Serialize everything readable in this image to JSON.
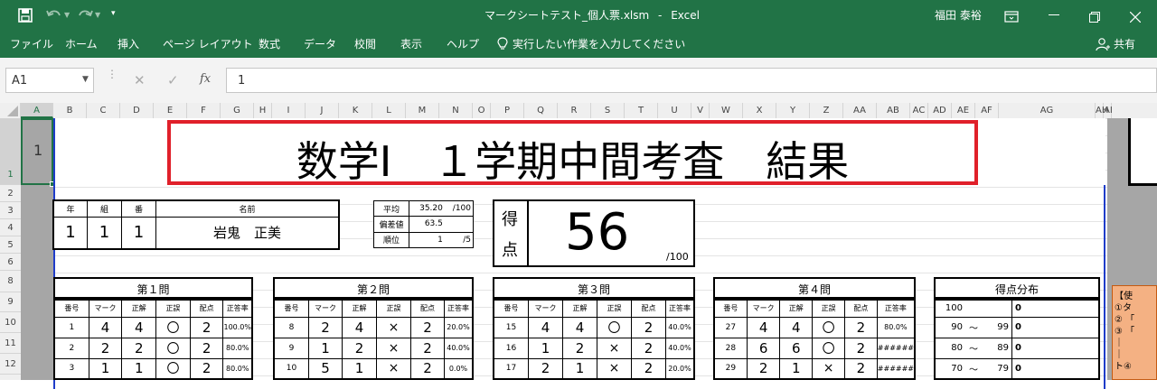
{
  "titlebar": {
    "filename": "マークシートテスト_個人票.xlsm",
    "separator": "-",
    "app": "Excel",
    "user": "福田 泰裕"
  },
  "ribbon": {
    "tabs": [
      "ファイル",
      "ホーム",
      "挿入",
      "ページ レイアウト",
      "数式",
      "データ",
      "校閲",
      "表示",
      "ヘルプ"
    ],
    "tell_me": "実行したい作業を入力してください",
    "share": "共有"
  },
  "formula_bar": {
    "name_box": "A1",
    "formula": "1"
  },
  "columns": [
    "A",
    "B",
    "C",
    "D",
    "E",
    "F",
    "G",
    "H",
    "I",
    "J",
    "K",
    "L",
    "M",
    "N",
    "O",
    "P",
    "Q",
    "R",
    "S",
    "T",
    "U",
    "V",
    "W",
    "X",
    "Y",
    "Z",
    "AA",
    "AB",
    "AC",
    "AD",
    "AE",
    "AF",
    "AG",
    "AH",
    "AI"
  ],
  "rows": [
    "1",
    "2",
    "3",
    "4",
    "5",
    "6",
    "8",
    "9",
    "10",
    "11",
    "12"
  ],
  "sheet": {
    "a1_value": "1",
    "title": "数学Ⅰ　１学期中間考査　結果",
    "student": {
      "headers": [
        "年",
        "組",
        "番",
        "名前"
      ],
      "values": [
        "1",
        "1",
        "1",
        "岩鬼　正美"
      ]
    },
    "stats": {
      "avg_label": "平均",
      "avg_value": "35.20",
      "avg_unit": "/100",
      "dev_label": "偏差値",
      "dev_value": "63.5",
      "rank_label": "順位",
      "rank_value": "1",
      "rank_unit": "/5"
    },
    "score": {
      "label1": "得",
      "label2": "点",
      "value": "56",
      "unit": "/100"
    },
    "questions": [
      {
        "title": "第１問",
        "headers": [
          "番号",
          "マーク",
          "正解",
          "正誤",
          "配点",
          "正答率"
        ],
        "rows": [
          [
            "1",
            "4",
            "4",
            "〇",
            "2",
            "100.0%"
          ],
          [
            "2",
            "2",
            "2",
            "〇",
            "2",
            "80.0%"
          ],
          [
            "3",
            "1",
            "1",
            "〇",
            "2",
            "80.0%"
          ]
        ]
      },
      {
        "title": "第２問",
        "headers": [
          "番号",
          "マーク",
          "正解",
          "正誤",
          "配点",
          "正答率"
        ],
        "rows": [
          [
            "8",
            "2",
            "4",
            "×",
            "2",
            "20.0%"
          ],
          [
            "9",
            "1",
            "2",
            "×",
            "2",
            "40.0%"
          ],
          [
            "10",
            "5",
            "1",
            "×",
            "2",
            "0.0%"
          ]
        ]
      },
      {
        "title": "第３問",
        "headers": [
          "番号",
          "マーク",
          "正解",
          "正誤",
          "配点",
          "正答率"
        ],
        "rows": [
          [
            "15",
            "4",
            "4",
            "〇",
            "2",
            "40.0%"
          ],
          [
            "16",
            "1",
            "2",
            "×",
            "2",
            "40.0%"
          ],
          [
            "17",
            "2",
            "1",
            "×",
            "2",
            "20.0%"
          ]
        ]
      },
      {
        "title": "第４問",
        "headers": [
          "番号",
          "マーク",
          "正解",
          "正誤",
          "配点",
          "正答率"
        ],
        "rows": [
          [
            "27",
            "4",
            "4",
            "〇",
            "2",
            "80.0%"
          ],
          [
            "28",
            "6",
            "6",
            "〇",
            "2",
            "######"
          ],
          [
            "29",
            "2",
            "1",
            "×",
            "2",
            "######"
          ]
        ]
      }
    ],
    "distribution": {
      "title": "得点分布",
      "rows": [
        [
          "100",
          "",
          "",
          "0"
        ],
        [
          "90",
          "〜",
          "99",
          "0"
        ],
        [
          "80",
          "〜",
          "89",
          "0"
        ],
        [
          "70",
          "〜",
          "79",
          "0"
        ]
      ]
    },
    "side_note": [
      "【使",
      "①タ",
      "② 「",
      "③ 「",
      "｜",
      "｜",
      "ト④"
    ]
  },
  "colors": {
    "excel_green": "#217346",
    "highlight_red": "#e0202a",
    "print_border_blue": "#1f3cc9",
    "note_bg": "#f4b183"
  }
}
